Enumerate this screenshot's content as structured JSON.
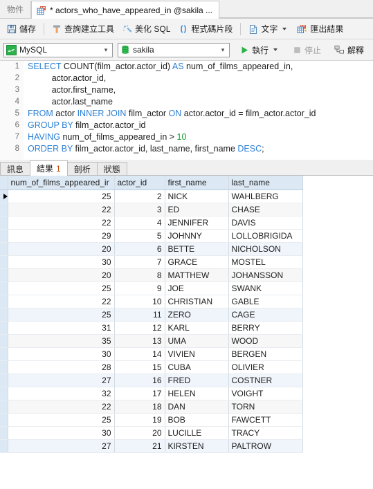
{
  "window": {
    "tabs": [
      {
        "label": "物件",
        "icon": "objects-icon",
        "active": false
      },
      {
        "label": "* actors_who_have_appeared_in @sakila ...",
        "icon": "query-table-icon",
        "active": true
      }
    ]
  },
  "toolbar_main": {
    "items": [
      {
        "label": "儲存",
        "icon": "save-floppy-icon",
        "enabled": true
      },
      {
        "label": "查詢建立工具",
        "icon": "query-builder-icon",
        "enabled": true
      },
      {
        "label": "美化 SQL",
        "icon": "magic-wand-icon",
        "enabled": true
      },
      {
        "label": "程式碼片段",
        "icon": "code-snippet-parens-icon",
        "enabled": true
      },
      {
        "label": "文字",
        "icon": "text-document-icon",
        "enabled": true,
        "has_dropdown": true
      },
      {
        "label": "匯出結果",
        "icon": "export-results-icon",
        "enabled": true
      }
    ]
  },
  "toolbar_run": {
    "connection": {
      "value": "MySQL",
      "icon": "mysql-dolphin-icon"
    },
    "database": {
      "value": "sakila",
      "icon": "database-cylinder-icon"
    },
    "run": {
      "label": "執行",
      "icon": "play-triangle-icon",
      "enabled": true,
      "has_dropdown": true
    },
    "stop": {
      "label": "停止",
      "icon": "stop-square-icon",
      "enabled": false
    },
    "explain": {
      "label": "解釋",
      "icon": "explain-plan-icon",
      "enabled": true
    }
  },
  "editor": {
    "line_numbers": [
      "1",
      "2",
      "3",
      "4",
      "5",
      "6",
      "7",
      "8"
    ],
    "colors": {
      "keyword": "#2a7fd4",
      "number": "#149b2f",
      "identifier": "#1d1d1d"
    },
    "lines": [
      [
        {
          "t": "SELECT",
          "k": "kw"
        },
        {
          "t": " COUNT(film_actor.actor_id) ",
          "k": "id"
        },
        {
          "t": "AS",
          "k": "kw"
        },
        {
          "t": " num_of_films_appeared_in,",
          "k": "id"
        }
      ],
      [
        {
          "t": "          actor.actor_id,",
          "k": "id"
        }
      ],
      [
        {
          "t": "          actor.first_name,",
          "k": "id"
        }
      ],
      [
        {
          "t": "          actor.last_name",
          "k": "id"
        }
      ],
      [
        {
          "t": "FROM",
          "k": "kw"
        },
        {
          "t": " actor ",
          "k": "id"
        },
        {
          "t": "INNER JOIN",
          "k": "kw"
        },
        {
          "t": " film_actor ",
          "k": "id"
        },
        {
          "t": "ON",
          "k": "kw"
        },
        {
          "t": " actor.actor_id = film_actor.actor_id",
          "k": "id"
        }
      ],
      [
        {
          "t": "GROUP BY",
          "k": "kw"
        },
        {
          "t": " film_actor.actor_id",
          "k": "id"
        }
      ],
      [
        {
          "t": "HAVING",
          "k": "kw"
        },
        {
          "t": " num_of_films_appeared_in > ",
          "k": "id"
        },
        {
          "t": "10",
          "k": "num"
        }
      ],
      [
        {
          "t": "ORDER BY",
          "k": "kw"
        },
        {
          "t": " film_actor.actor_id, last_name, first_name ",
          "k": "id"
        },
        {
          "t": "DESC",
          "k": "kw"
        },
        {
          "t": ";",
          "k": "id"
        }
      ]
    ]
  },
  "result_tabs": [
    {
      "label": "訊息",
      "count": "",
      "active": false
    },
    {
      "label": "結果",
      "count": "1",
      "active": true
    },
    {
      "label": "剖析",
      "count": "",
      "active": false
    },
    {
      "label": "狀態",
      "count": "",
      "active": false
    }
  ],
  "grid": {
    "headers": [
      "num_of_films_appeared_ir",
      "actor_id",
      "first_name",
      "last_name"
    ],
    "current_row": 0,
    "rows": [
      [
        "25",
        "2",
        "NICK",
        "WAHLBERG"
      ],
      [
        "22",
        "3",
        "ED",
        "CHASE"
      ],
      [
        "22",
        "4",
        "JENNIFER",
        "DAVIS"
      ],
      [
        "29",
        "5",
        "JOHNNY",
        "LOLLOBRIGIDA"
      ],
      [
        "20",
        "6",
        "BETTE",
        "NICHOLSON"
      ],
      [
        "30",
        "7",
        "GRACE",
        "MOSTEL"
      ],
      [
        "20",
        "8",
        "MATTHEW",
        "JOHANSSON"
      ],
      [
        "25",
        "9",
        "JOE",
        "SWANK"
      ],
      [
        "22",
        "10",
        "CHRISTIAN",
        "GABLE"
      ],
      [
        "25",
        "11",
        "ZERO",
        "CAGE"
      ],
      [
        "31",
        "12",
        "KARL",
        "BERRY"
      ],
      [
        "35",
        "13",
        "UMA",
        "WOOD"
      ],
      [
        "30",
        "14",
        "VIVIEN",
        "BERGEN"
      ],
      [
        "28",
        "15",
        "CUBA",
        "OLIVIER"
      ],
      [
        "27",
        "16",
        "FRED",
        "COSTNER"
      ],
      [
        "32",
        "17",
        "HELEN",
        "VOIGHT"
      ],
      [
        "22",
        "18",
        "DAN",
        "TORN"
      ],
      [
        "25",
        "19",
        "BOB",
        "FAWCETT"
      ],
      [
        "30",
        "20",
        "LUCILLE",
        "TRACY"
      ],
      [
        "27",
        "21",
        "KIRSTEN",
        "PALTROW"
      ]
    ]
  }
}
